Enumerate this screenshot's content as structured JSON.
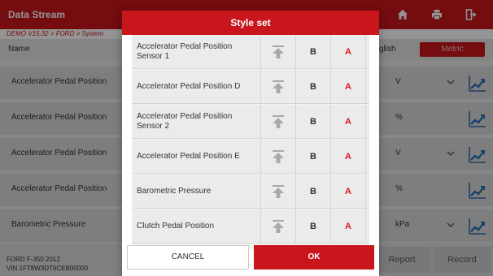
{
  "app": {
    "title": "Data Stream",
    "breadcrumb": "DEMO V15.32 > FORD > System",
    "columns": {
      "name": "Name",
      "units_english": "glish",
      "units_metric": "Metric"
    }
  },
  "rows": [
    {
      "name": "Accelerator Pedal Position",
      "unit": "V",
      "has_dropdown": true
    },
    {
      "name": "Accelerator Pedal Position",
      "unit": "%",
      "has_dropdown": false
    },
    {
      "name": "Accelerator Pedal Position",
      "unit": "V",
      "has_dropdown": true
    },
    {
      "name": "Accelerator Pedal Position",
      "unit": "%",
      "has_dropdown": false
    },
    {
      "name": "Barometric Pressure",
      "unit": "kPa",
      "has_dropdown": true
    }
  ],
  "footer": {
    "vehicle_line1": "FORD F-350 2012",
    "vehicle_line2": "VIN 1FT8W3DT9CEB00000",
    "report_label": "Report",
    "record_label": "Record"
  },
  "dialog": {
    "title": "Style set",
    "bold_label": "B",
    "color_label": "A",
    "items": [
      "Accelerator Pedal Position Sensor 1",
      "Accelerator Pedal Position D",
      "Accelerator Pedal Position Sensor 2",
      "Accelerator Pedal Position E",
      "Barometric Pressure",
      "Clutch Pedal Position"
    ],
    "cancel_label": "CANCEL",
    "ok_label": "OK"
  },
  "colors": {
    "brand_red": "#c9161d",
    "accent_blue": "#2d6fb5",
    "color_text_red": "#d81920"
  },
  "icons": {
    "toolbar": [
      "home-icon",
      "print-icon",
      "exit-icon"
    ],
    "row": [
      "chevron-down-icon",
      "graph-icon"
    ],
    "item": [
      "move-to-top-icon"
    ]
  }
}
